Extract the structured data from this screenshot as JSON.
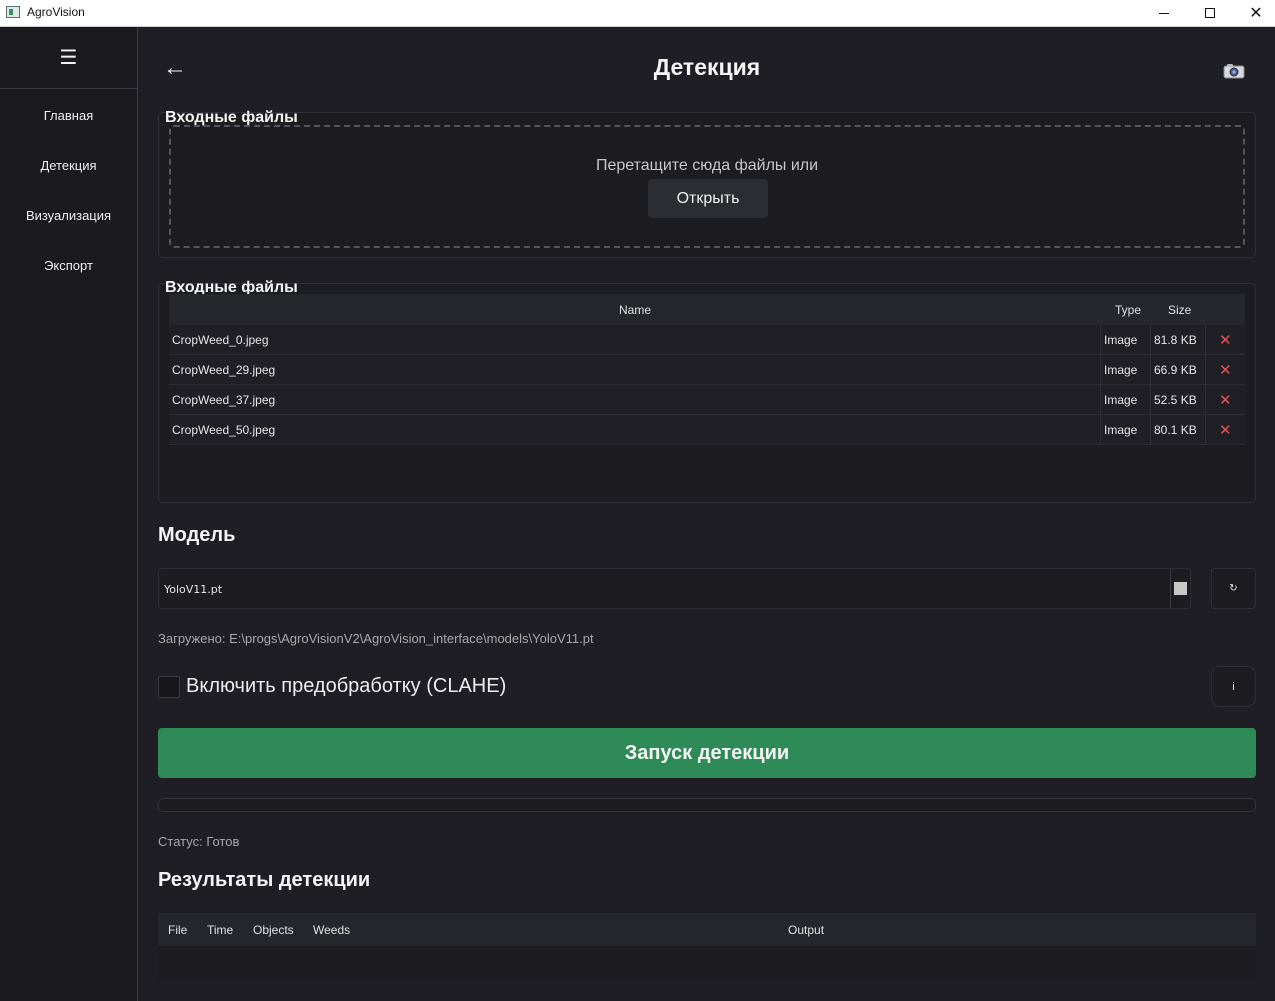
{
  "window": {
    "title": "AgroVision",
    "minimize_icon": "minimize-icon",
    "maximize_icon": "maximize-icon",
    "close_symbol": "✕"
  },
  "sidebar": {
    "menu_symbol": "☰",
    "items": [
      {
        "label": "Главная"
      },
      {
        "label": "Детекция"
      },
      {
        "label": "Визуализация"
      },
      {
        "label": "Экспорт"
      }
    ]
  },
  "header": {
    "back_symbol": "←",
    "title": "Детекция",
    "camera_icon": "camera-icon"
  },
  "input_files": {
    "group_title": "Входные файлы",
    "drop_hint": "Перетащите сюда файлы или",
    "open_label": "Открыть"
  },
  "file_list": {
    "group_title": "Входные файлы",
    "columns": {
      "name": "Name",
      "type": "Type",
      "size": "Size"
    },
    "delete_symbol": "✕",
    "rows": [
      {
        "name": "CropWeed_0.jpeg",
        "type": "Image",
        "size": "81.8 KB"
      },
      {
        "name": "CropWeed_29.jpeg",
        "type": "Image",
        "size": "66.9 KB"
      },
      {
        "name": "CropWeed_37.jpeg",
        "type": "Image",
        "size": "52.5 KB"
      },
      {
        "name": "CropWeed_50.jpeg",
        "type": "Image",
        "size": "80.1 KB"
      }
    ]
  },
  "model": {
    "section_title": "Модель",
    "selected": "YoloV11.pt",
    "refresh_symbol": "↻",
    "loaded_text": "Загружено: E:\\progs\\AgroVisionV2\\AgroVision_interface\\models\\YoloV11.pt"
  },
  "preprocess": {
    "label": "Включить предобработку (CLAHE)",
    "checked": false,
    "info_label": "i"
  },
  "run": {
    "label": "Запуск детекции",
    "color": "#2e8b57"
  },
  "progress": {
    "value": 0
  },
  "status": {
    "text": "Статус: Готов"
  },
  "results": {
    "section_title": "Результаты детекции",
    "columns": {
      "file": "File",
      "time": "Time",
      "objects": "Objects",
      "weeds": "Weeds",
      "output": "Output"
    }
  }
}
